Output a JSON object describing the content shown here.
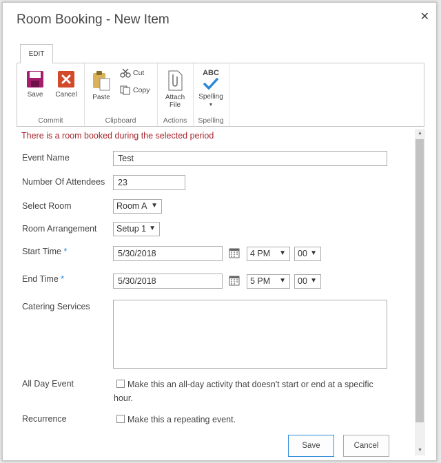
{
  "dialog": {
    "title": "Room Booking - New Item",
    "close_icon": "close-icon"
  },
  "ribbon": {
    "tab": "EDIT",
    "commit": {
      "label": "Commit",
      "save": "Save",
      "cancel": "Cancel"
    },
    "clipboard": {
      "label": "Clipboard",
      "paste": "Paste",
      "cut": "Cut",
      "copy": "Copy"
    },
    "actions": {
      "label": "Actions",
      "attach_line1": "Attach",
      "attach_line2": "File"
    },
    "spelling": {
      "label": "Spelling",
      "button": "Spelling",
      "abc": "ABC"
    }
  },
  "colors": {
    "error": "#a4262c",
    "required": "#2b88d8",
    "save_icon": "#a51e6e",
    "cancel_icon": "#d04a2b"
  },
  "form": {
    "error": "There is a room booked during the selected period",
    "event_name": {
      "label": "Event Name",
      "value": "Test"
    },
    "attendees": {
      "label": "Number Of Attendees",
      "value": "23"
    },
    "room": {
      "label": "Select Room",
      "value": "Room A"
    },
    "arrangement": {
      "label": "Room Arrangement",
      "value": "Setup 1"
    },
    "start": {
      "label": "Start Time",
      "date": "5/30/2018",
      "hour": "4 PM",
      "minute": "00"
    },
    "end": {
      "label": "End Time",
      "date": "5/30/2018",
      "hour": "5 PM",
      "minute": "00"
    },
    "required_marker": "*",
    "catering": {
      "label": "Catering Services",
      "value": ""
    },
    "all_day": {
      "label": "All Day Event",
      "line1": "Make this an all-day activity that doesn't start or end at a specific",
      "line2": "hour."
    },
    "recurrence": {
      "label": "Recurrence",
      "text": "Make this a repeating event."
    },
    "save": "Save",
    "cancel": "Cancel"
  }
}
